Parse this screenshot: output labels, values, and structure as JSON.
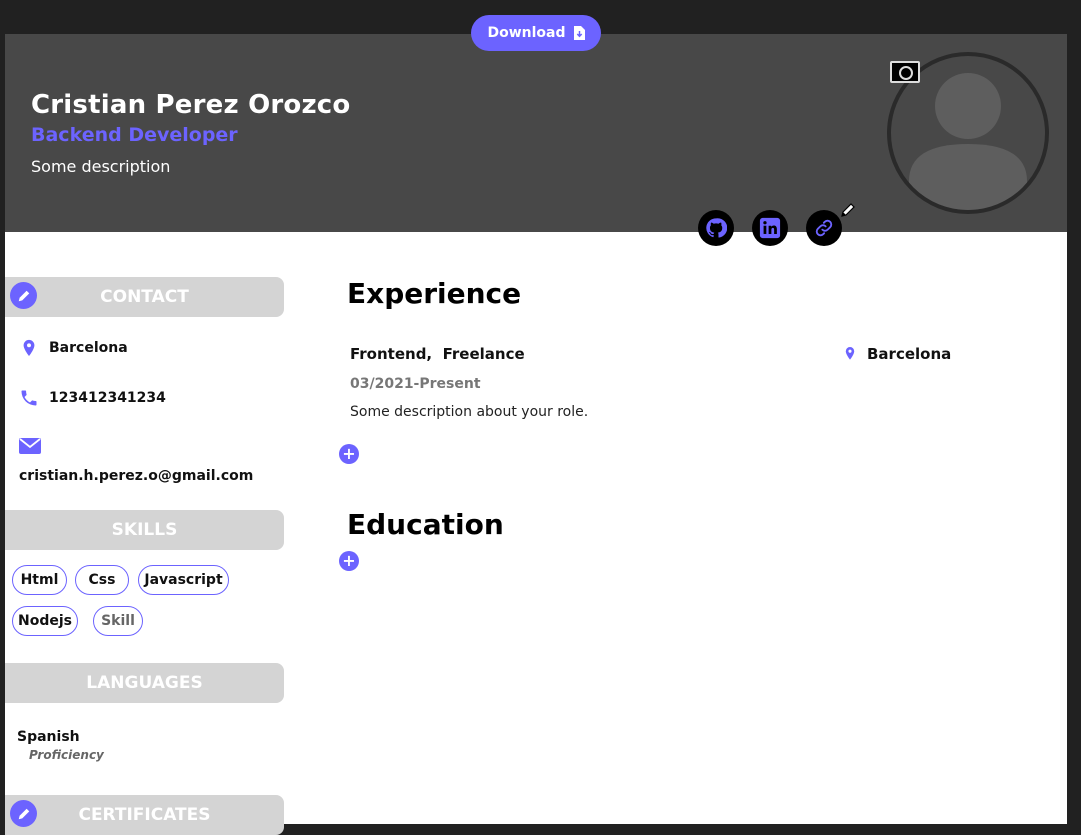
{
  "toolbar": {
    "download_label": "Download"
  },
  "header": {
    "name": "Cristian Perez Orozco",
    "role": "Backend Developer",
    "description": "Some description"
  },
  "sidebar": {
    "contact": {
      "title": "CONTACT",
      "location": "Barcelona",
      "phone": "123412341234",
      "email": "cristian.h.perez.o@gmail.com"
    },
    "skills": {
      "title": "SKILLS",
      "items": [
        "Html",
        "Css",
        "Javascript",
        "Nodejs"
      ],
      "placeholder": "Skill"
    },
    "languages": {
      "title": "LANGUAGES",
      "items": [
        {
          "name": "Spanish",
          "level": "Proficiency"
        }
      ]
    },
    "certificates": {
      "title": "CERTIFICATES"
    }
  },
  "main": {
    "experience": {
      "title": "Experience",
      "items": [
        {
          "role": "Frontend,",
          "company": "Freelance",
          "location": "Barcelona",
          "dates": "03/2021-Present",
          "description": "Some description about your role."
        }
      ]
    },
    "education": {
      "title": "Education"
    }
  },
  "colors": {
    "accent": "#6c63ff",
    "header_bg": "#484848",
    "section_bg": "#d4d4d4"
  },
  "icons": [
    "download-icon",
    "camera-icon",
    "github-icon",
    "linkedin-icon",
    "link-icon",
    "pencil-icon",
    "location-pin-icon",
    "phone-icon",
    "envelope-icon",
    "plus-icon"
  ]
}
